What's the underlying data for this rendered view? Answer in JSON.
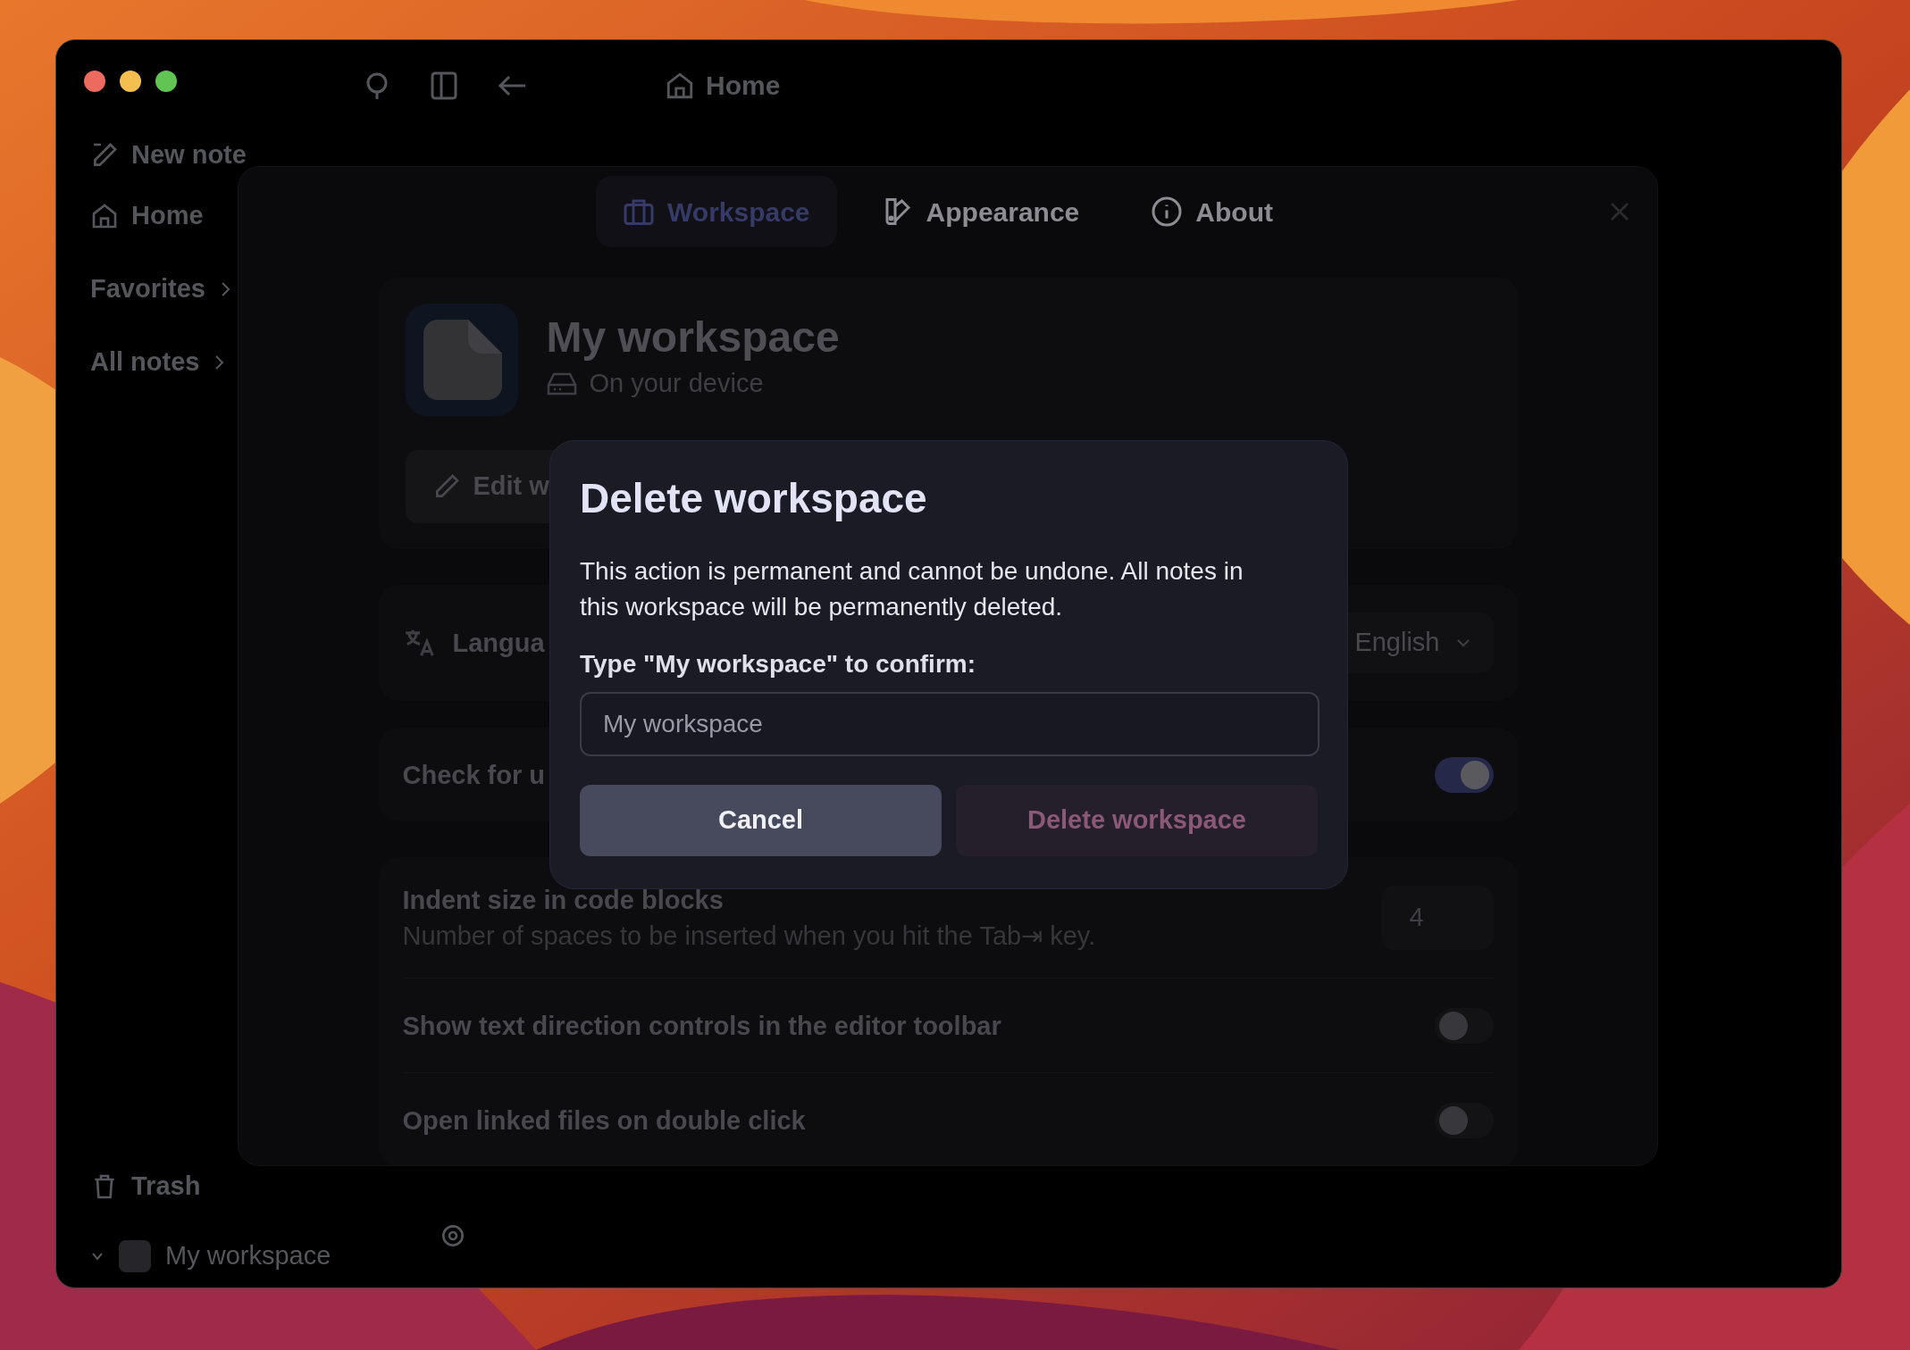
{
  "toolbar": {
    "location": "Home"
  },
  "sidebar": {
    "items": [
      {
        "label": "New note",
        "kind": "new"
      },
      {
        "label": "Home",
        "kind": "home"
      },
      {
        "label": "Favorites",
        "kind": "group"
      },
      {
        "label": "All notes",
        "kind": "group"
      }
    ],
    "footer": [
      {
        "label": "Trash",
        "kind": "trash"
      }
    ],
    "workspace": "My workspace"
  },
  "settings": {
    "tabs": [
      {
        "label": "Workspace",
        "kind": "workspace",
        "selected": true
      },
      {
        "label": "Appearance",
        "kind": "appearance",
        "selected": false
      },
      {
        "label": "About",
        "kind": "about",
        "selected": false
      }
    ],
    "workspace": {
      "name": "My workspace",
      "location": "On your device",
      "edit_button": "Edit w"
    },
    "groups": [
      [
        {
          "kind": "select",
          "label": "Langua",
          "value": "English"
        }
      ],
      [
        {
          "kind": "toggle",
          "label": "Check for u",
          "on": true
        }
      ],
      [
        {
          "kind": "number",
          "label": "Indent size in code blocks",
          "description": "Number of spaces to be inserted when you hit the Tab⇥ key.",
          "value": "4"
        },
        {
          "kind": "toggle",
          "label": "Show text direction controls in the editor toolbar",
          "on": false
        },
        {
          "kind": "toggle",
          "label": "Open linked files on double click",
          "on": false
        }
      ]
    ]
  },
  "dialog": {
    "title": "Delete workspace",
    "message": "This action is permanent and cannot be undone. All notes in this workspace will be permanently deleted.",
    "prompt": "Type \"My workspace\" to confirm:",
    "input": {
      "placeholder": "My workspace"
    },
    "buttons": [
      {
        "label": "Cancel",
        "kind": "secondary",
        "disabled": false
      },
      {
        "label": "Delete workspace",
        "kind": "danger",
        "disabled": true
      }
    ]
  }
}
